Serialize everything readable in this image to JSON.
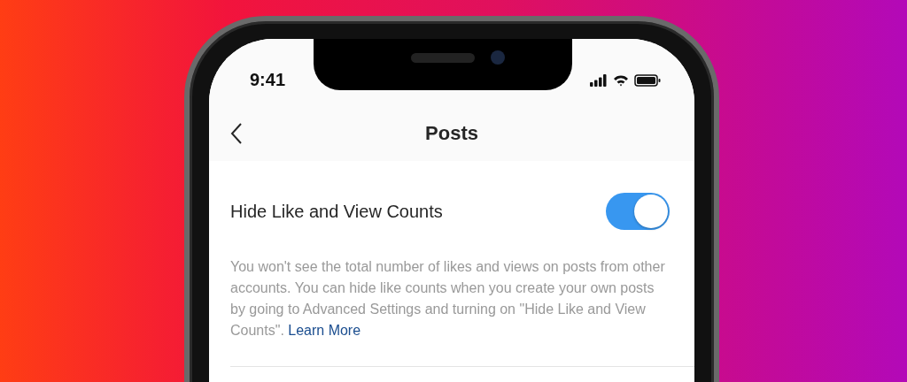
{
  "status_bar": {
    "time": "9:41"
  },
  "header": {
    "title": "Posts"
  },
  "setting": {
    "label": "Hide Like and View Counts",
    "on": true,
    "description": "You won't see the total number of likes and views on posts from other accounts. You can hide like counts when you create your own posts by going to Advanced Settings and turning on \"Hide Like and View Counts\".",
    "link": "Learn More"
  }
}
